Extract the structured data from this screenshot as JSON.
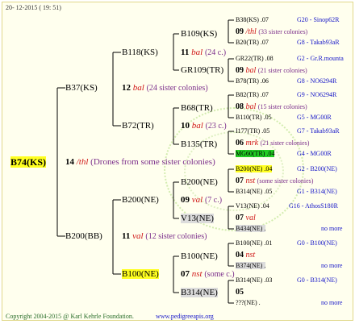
{
  "header": {
    "date": "20- 12-2015 ( 19: 51)"
  },
  "footer": {
    "copyright": "Copyright 2004-2015 @ Karl Kehrle Foundation.",
    "url": "www.pedigreeapis.org"
  },
  "root": {
    "name": "B74(KS)",
    "gen": "14",
    "symbol": "/thl",
    "note": "(Drones from some sister colonies)"
  },
  "g1": {
    "top": {
      "name": "B37(KS)",
      "gen": "12",
      "symbol": "bal",
      "note": "(24 sister colonies)"
    },
    "bottom": {
      "name": "B200(BB)",
      "gen": "11",
      "symbol": "val",
      "note": "(12 sister colonies)"
    }
  },
  "g2": {
    "a": {
      "name": "B118(KS)",
      "gen": "11",
      "symbol": "bal",
      "note": "(24 c.)"
    },
    "b": {
      "name": "B72(TR)",
      "gen": "10",
      "symbol": "bal",
      "note": "(23 c.)"
    },
    "c": {
      "name": "B200(NE)",
      "gen": "09",
      "symbol": "val",
      "note": "(7 c.)"
    },
    "d": {
      "name": "B100(NE)",
      "gen": "07",
      "symbol": "nst",
      "note": "(some c.)"
    }
  },
  "g3": {
    "a1": "B109(KS)",
    "a2": "GR109(TR)",
    "b1": "B68(TR)",
    "b2": "B135(TR)",
    "c1": "B200(NE)",
    "c2": "V13(NE)",
    "d1": "B100(NE)",
    "d2": "B314(NE)"
  },
  "g4": {
    "r01": {
      "name": "B38(KS)",
      "year": ".07",
      "right": "G20 - Sinop62R"
    },
    "m01": {
      "gen": "09",
      "symbol": "/thl",
      "note": "(33 sister colonies)"
    },
    "r02": {
      "name": "B20(TR)",
      "year": ".07",
      "right": "G8 - Takab93aR"
    },
    "r03": {
      "name": "GR22(TR)",
      "year": ".08",
      "right": "G2 - Gr.R.mounta"
    },
    "m02": {
      "gen": "09",
      "symbol": "bal",
      "note": "(21 sister colonies)"
    },
    "r04": {
      "name": "B78(TR)",
      "year": ".06",
      "right": "G8 - NO6294R"
    },
    "r05": {
      "name": "B82(TR)",
      "year": ".07",
      "right": "G9 - NO6294R"
    },
    "m03": {
      "gen": "08",
      "symbol": "bal",
      "note": "(15 sister colonies)"
    },
    "r06": {
      "name": "B110(TR)",
      "year": ".05",
      "right": "G5 - MG00R"
    },
    "r07": {
      "name": "I177(TR)",
      "year": ".05",
      "right": "G7 - Takab93aR"
    },
    "m04": {
      "gen": "06",
      "symbol": "mrk",
      "note": "(21 sister colonies)"
    },
    "r08": {
      "name": "MG60(TR)",
      "year": ".04",
      "right": "G4 - MG00R"
    },
    "r09": {
      "name": "B200(NE)",
      "year": ".04",
      "right": "G2 - B200(NE)"
    },
    "m05": {
      "gen": "07",
      "symbol": "nst",
      "note": "(some sister colonies)"
    },
    "r10": {
      "name": "B314(NE)",
      "year": ".05",
      "right": "G1 - B314(NE)"
    },
    "r11": {
      "name": "V13(NE)",
      "year": ".04",
      "right": "G16 - AthosS180R"
    },
    "m06": {
      "gen": "07",
      "symbol": "val",
      "note": ""
    },
    "r12": {
      "name": "B434(NE)",
      "year": ".",
      "right": "no more"
    },
    "r13": {
      "name": "B100(NE)",
      "year": ".01",
      "right": "G0 - B100(NE)"
    },
    "m07": {
      "gen": "04",
      "symbol": "nst",
      "note": ""
    },
    "r14": {
      "name": "B374(NE)",
      "year": ".",
      "right": "no more"
    },
    "r15": {
      "name": "B314(NE)",
      "year": ".03",
      "right": "G0 - B314(NE)"
    },
    "m08": {
      "gen": "05",
      "symbol": "",
      "note": ""
    },
    "r16": {
      "name": "???(NE)",
      "year": ".",
      "right": "no more"
    }
  }
}
